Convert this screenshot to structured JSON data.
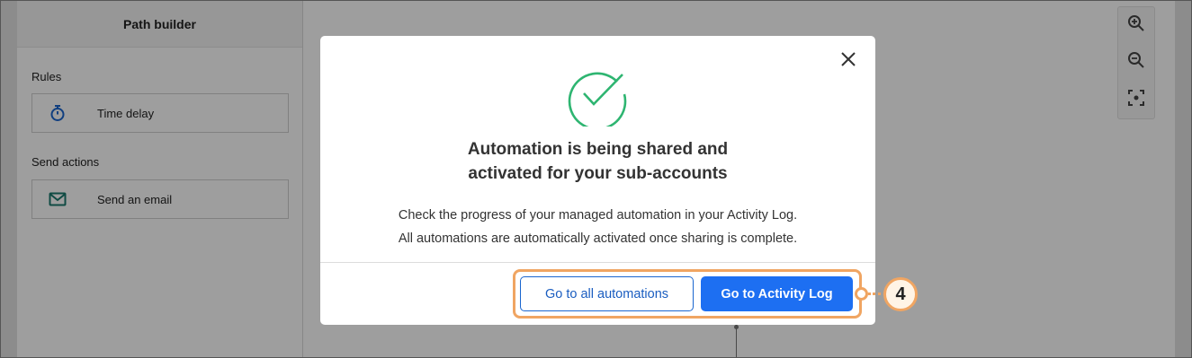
{
  "sidebar": {
    "title": "Path builder",
    "sections": [
      {
        "label": "Rules",
        "items": [
          {
            "label": "Time delay",
            "icon": "stopwatch-icon"
          }
        ]
      },
      {
        "label": "Send actions",
        "items": [
          {
            "label": "Send an email",
            "icon": "envelope-icon"
          }
        ]
      }
    ]
  },
  "zoom_controls": {
    "icons": [
      "zoom-in-icon",
      "zoom-out-icon",
      "focus-center-icon"
    ]
  },
  "modal": {
    "title_line1": "Automation is being shared and",
    "title_line2": "activated for your sub-accounts",
    "body_line1": "Check the progress of your managed automation in your Activity Log.",
    "body_line2": "All automations are automatically activated once sharing is complete.",
    "secondary_button": "Go to all automations",
    "primary_button": "Go to Activity Log"
  },
  "callout": {
    "step_number": "4"
  },
  "colors": {
    "primary": "#1d6ff2",
    "success_check": "#2eb571",
    "callout_orange": "#f0a562",
    "icon_blue": "#1a66cf",
    "icon_teal": "#1a7a6e"
  }
}
